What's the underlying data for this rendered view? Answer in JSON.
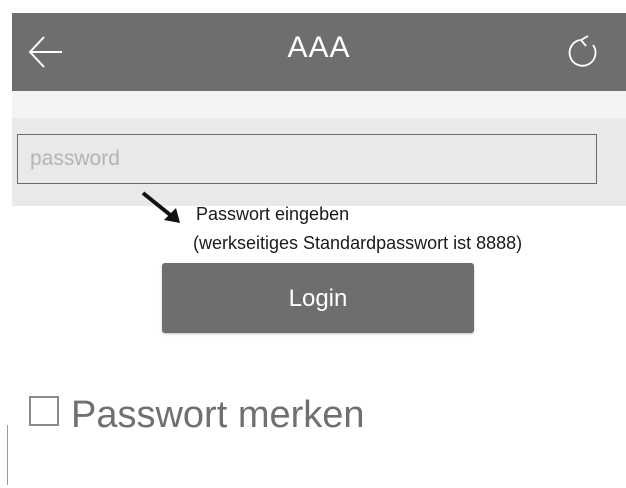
{
  "header": {
    "title": "AAA",
    "back_icon": "arrow-left-icon",
    "refresh_icon": "refresh-icon",
    "background": "#6e6e6e"
  },
  "login_form": {
    "password_placeholder": "password",
    "password_value": "",
    "hint_line1": "Passwort eingeben",
    "hint_line2": "(werkseitiges Standardpasswort ist 8888)",
    "login_label": "Login",
    "remember_label": "Passwort merken",
    "remember_checked": false
  }
}
